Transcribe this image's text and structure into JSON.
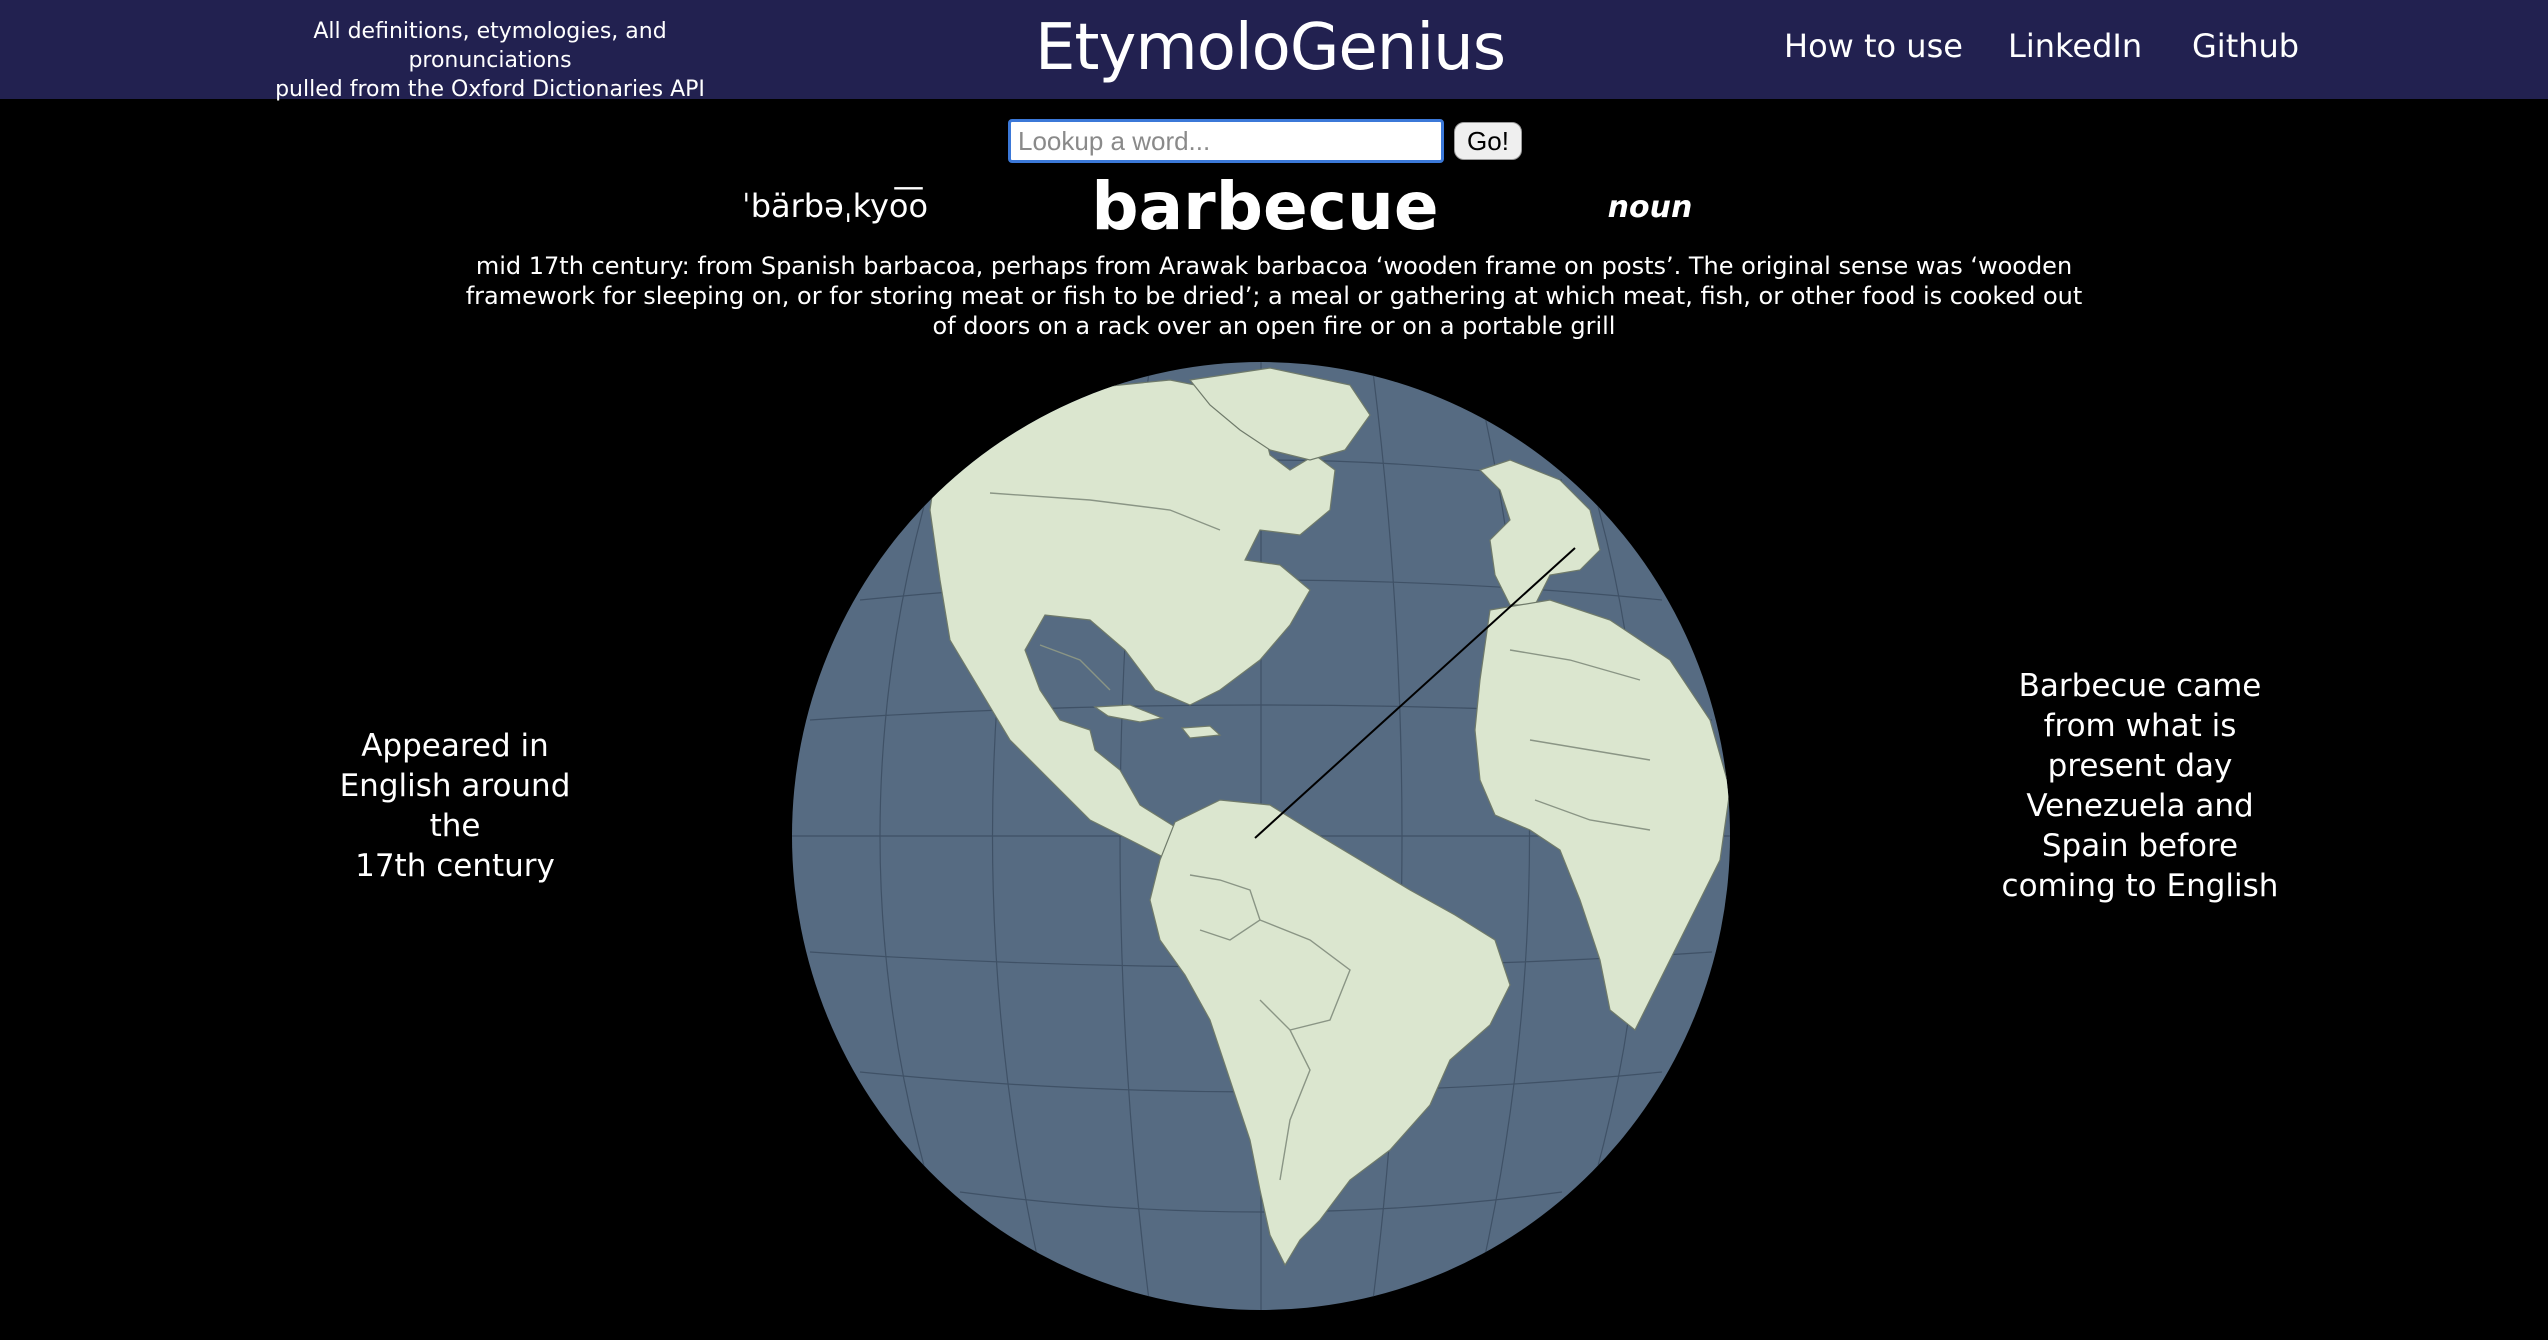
{
  "header": {
    "credit_line1": "All definitions, etymologies, and pronunciations",
    "credit_line2": "pulled from the Oxford Dictionaries API",
    "brand": "EtymoloGenius",
    "nav": [
      {
        "label": "How to use"
      },
      {
        "label": "LinkedIn"
      },
      {
        "label": "Github"
      }
    ]
  },
  "search": {
    "placeholder": "Lookup a word...",
    "value": "",
    "button_label": "Go!"
  },
  "entry": {
    "pronunciation": "ˈbärbəˌkyo͞o",
    "word": "barbecue",
    "part_of_speech": "noun",
    "etymology": "mid 17th century: from Spanish barbacoa, perhaps from Arawak barbacoa ‘wooden frame on posts’. The original sense was ‘wooden framework for sleeping on, or for storing meat or fish to be dried’; a meal or gathering at which meat, fish, or other food is cooked out of doors on a rack over an open fire or on a portable grill"
  },
  "notes": {
    "left_line1": "Appeared in",
    "left_line2": "English around the",
    "left_line3": "17th century",
    "right_line1": "Barbecue came",
    "right_line2": "from what is",
    "right_line3": "present day",
    "right_line4": "Venezuela and",
    "right_line5": "Spain before",
    "right_line6": "coming to English"
  },
  "globe": {
    "ocean_color": "#566b82",
    "land_color": "#dbe6cf",
    "graticule_color": "#3f5166",
    "route_color": "#000000",
    "route_from": "Venezuela",
    "route_to": "Spain"
  },
  "colors": {
    "header_bg": "#222150",
    "page_bg": "#000000",
    "text": "#ffffff",
    "input_border": "#3b78d8"
  }
}
